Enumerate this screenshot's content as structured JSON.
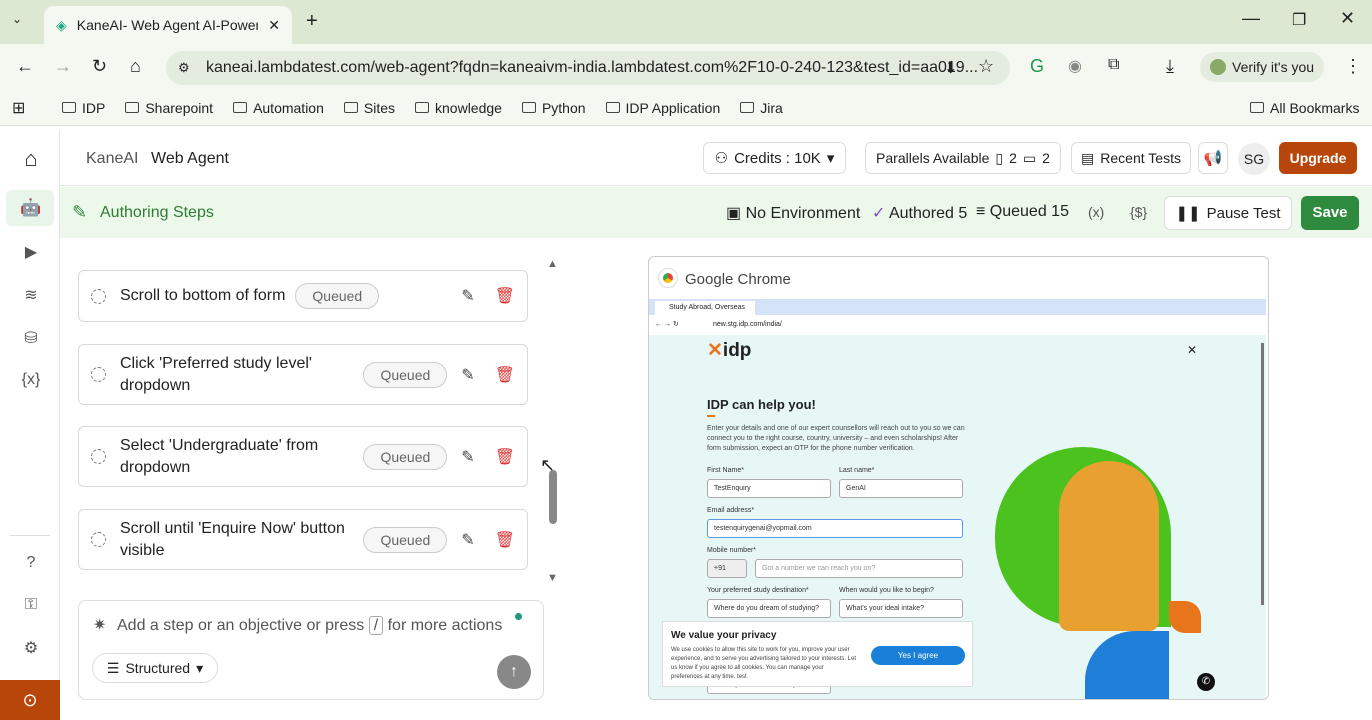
{
  "browser": {
    "tab_title": "KaneAI- Web Agent AI-Powered",
    "url": "kaneai.lambdatest.com/web-agent?fqdn=kaneaivm-india.lambdatest.com%2F10-0-240-123&test_id=aa019...",
    "verify": "Verify it's you",
    "bookmarks": [
      "IDP",
      "Sharepoint",
      "Automation",
      "Sites",
      "knowledge",
      "Python",
      "IDP Application",
      "Jira"
    ],
    "all_bookmarks": "All Bookmarks"
  },
  "header": {
    "brand": "KaneAI",
    "title": "Web Agent",
    "credits": "Credits : 10K",
    "parallels": "Parallels Available",
    "par1": "2",
    "par2": "2",
    "recent": "Recent Tests",
    "avatar": "SG",
    "upgrade": "Upgrade"
  },
  "subheader": {
    "title": "Authoring Steps",
    "env": "No Environment",
    "authored": "Authored 5",
    "queued": "Queued 15",
    "vars": "(x)",
    "secrets": "{$}",
    "pause": "Pause Test",
    "save": "Save"
  },
  "steps": [
    {
      "text": "Scroll to bottom of form",
      "status": "Queued"
    },
    {
      "text": "Click 'Preferred study level' dropdown",
      "status": "Queued"
    },
    {
      "text": "Select 'Undergraduate' from dropdown",
      "status": "Queued"
    },
    {
      "text": "Scroll until 'Enquire Now' button visible",
      "status": "Queued"
    }
  ],
  "composer": {
    "placeholder": "Add a step or an objective or press",
    "key": "/",
    "suffix": "for more actions",
    "mode": "Structured"
  },
  "preview": {
    "window_title": "Google Chrome",
    "tab": "Study Abroad, Overseas",
    "url": "new.stg.idp.com/india/",
    "logo": "idp",
    "heading": "IDP can help you!",
    "intro": "Enter your details and one of our expert counsellors will reach out to you so we can connect you to the right course, country, university – and even scholarships! After form submission, expect an OTP for the phone number verification.",
    "first_label": "First Name*",
    "first": "TestEnquiry",
    "last_label": "Last name*",
    "last": "GenAI",
    "email_label": "Email address*",
    "email": "testenquirygenai@yopmail.com",
    "mobile_label": "Mobile number*",
    "code": "+91",
    "mobile_ph": "Got a number we can reach you on?",
    "dest_label": "Your preferred study destination*",
    "dest": "Where do you dream of studying?",
    "begin_label": "When would you like to begin?",
    "begin": "What's your ideal intake?",
    "level": "Select your intended study level",
    "privacy_title": "We value your privacy",
    "privacy_text": "We use cookies to allow this site to work for you, improve your user experience, and to serve you advertising tailored to your interests. Let us know if you agree to all cookies. You can manage your preferences at any time. test",
    "agree": "Yes I agree"
  },
  "colors": {
    "accent": "#2e8b3e",
    "upgrade": "#b8460b",
    "subheader": "#ebf8ea"
  }
}
